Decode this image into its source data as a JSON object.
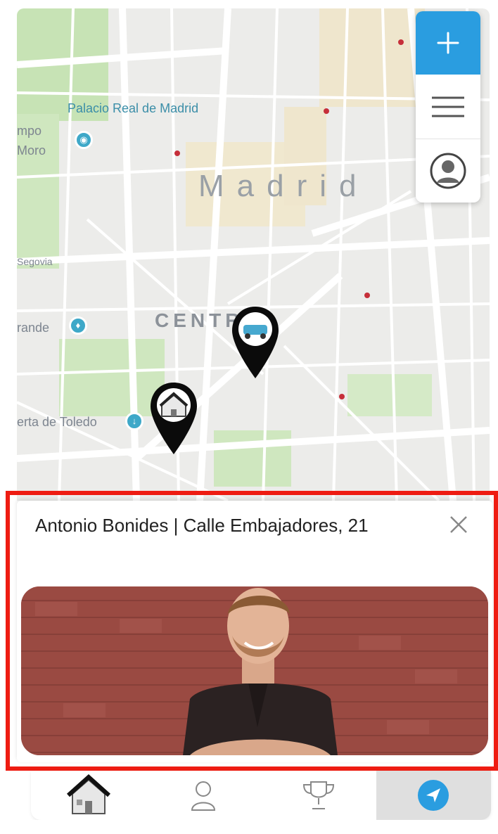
{
  "map": {
    "city": "Madrid",
    "district": "CENTR",
    "labels": {
      "palacio": "Palacio Real de Madrid",
      "campo_1": "mpo",
      "campo_2": "Moro",
      "segovia": "Segovia",
      "grande": "rande",
      "toledo": "erta de Toledo"
    },
    "icons": {
      "add": "plus-icon",
      "menu": "hamburger-menu-icon",
      "profile": "user-profile-icon",
      "pin_house": "house-map-pin-icon",
      "pin_car": "car-map-pin-icon"
    }
  },
  "card": {
    "title": "Antonio Bonides | Calle Embajadores, 21",
    "close_icon": "close-icon"
  },
  "tabs": [
    {
      "icon": "house-icon",
      "active": false
    },
    {
      "icon": "person-icon",
      "active": false
    },
    {
      "icon": "trophy-icon",
      "active": false
    },
    {
      "icon": "navigation-arrow-icon",
      "active": true
    }
  ],
  "colors": {
    "accent": "#2a9de0",
    "highlight": "#ee1c12",
    "map_bg": "#ececea",
    "park": "#c7e3b5"
  }
}
